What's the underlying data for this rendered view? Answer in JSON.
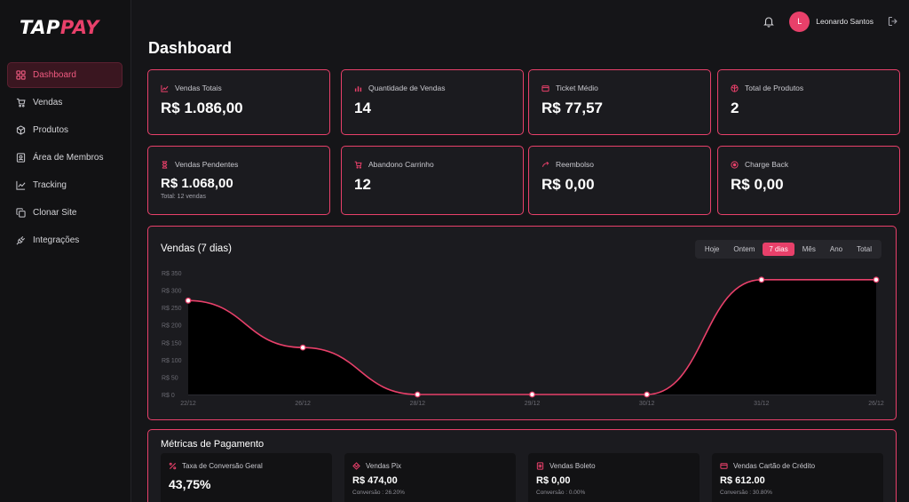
{
  "brand": {
    "logo_prefix": "TAP",
    "logo_accent": "PAY",
    "accent_color": "#e8406a"
  },
  "sidebar": {
    "items": [
      {
        "label": "Dashboard",
        "icon": "grid-icon",
        "active": true
      },
      {
        "label": "Vendas",
        "icon": "cart-icon"
      },
      {
        "label": "Produtos",
        "icon": "box-icon"
      },
      {
        "label": "Área de Membros",
        "icon": "member-card-icon"
      },
      {
        "label": "Tracking",
        "icon": "line-chart-icon"
      },
      {
        "label": "Clonar Site",
        "icon": "copy-icon"
      },
      {
        "label": "Integrações",
        "icon": "plug-icon"
      }
    ]
  },
  "header": {
    "avatar_initial": "L",
    "user_name": "Leonardo Santos"
  },
  "page": {
    "title": "Dashboard"
  },
  "stats": [
    {
      "label": "Vendas Totais",
      "value": "R$ 1.086,00",
      "icon": "trend-icon"
    },
    {
      "label": "Quantidade de Vendas",
      "value": "14",
      "icon": "bars-icon"
    },
    {
      "label": "Ticket Médio",
      "value": "R$ 77,57",
      "icon": "wallet-icon"
    },
    {
      "label": "Total de Produtos",
      "value": "2",
      "icon": "package-icon"
    },
    {
      "label": "Vendas Pendentes",
      "value": "R$ 1.068,00",
      "sub": "Total: 12 vendas",
      "icon": "hourglass-icon"
    },
    {
      "label": "Abandono Carrinho",
      "value": "12",
      "icon": "cart-x-icon"
    },
    {
      "label": "Reembolso",
      "value": "R$ 0,00",
      "icon": "refund-icon"
    },
    {
      "label": "Charge Back",
      "value": "R$ 0,00",
      "icon": "target-icon"
    }
  ],
  "sales_chart": {
    "title": "Vendas (7 dias)",
    "range_tabs": [
      "Hoje",
      "Ontem",
      "7 dias",
      "Mês",
      "Ano",
      "Total"
    ],
    "active_range": "7 dias"
  },
  "chart_data": {
    "type": "area",
    "title": "Vendas (7 dias)",
    "x": [
      "22/12",
      "26/12",
      "28/12",
      "29/12",
      "30/12",
      "31/12",
      "26/12"
    ],
    "values": [
      270,
      135,
      0,
      0,
      0,
      330,
      330
    ],
    "y_ticks": [
      "R$ 0",
      "R$ 50",
      "R$ 100",
      "R$ 150",
      "R$ 200",
      "R$ 250",
      "R$ 300",
      "R$ 350"
    ],
    "ylim": [
      0,
      350
    ],
    "line_color": "#e8406a",
    "fill_color": "#000000",
    "grid": false
  },
  "metrics": {
    "title": "Métricas de Pagamento",
    "items": [
      {
        "label": "Taxa de Conversão Geral",
        "value": "43,75%",
        "sub": "",
        "icon": "percent-icon"
      },
      {
        "label": "Vendas Pix",
        "value": "R$ 474,00",
        "sub": "Conversão : 26.20%",
        "icon": "pix-icon"
      },
      {
        "label": "Vendas Boleto",
        "value": "R$ 0,00",
        "sub": "Conversão : 0.00%",
        "icon": "boleto-icon"
      },
      {
        "label": "Vendas Cartão de Crédito",
        "value": "R$ 612.00",
        "sub": "Conversão : 30.80%",
        "icon": "credit-card-icon"
      }
    ]
  }
}
